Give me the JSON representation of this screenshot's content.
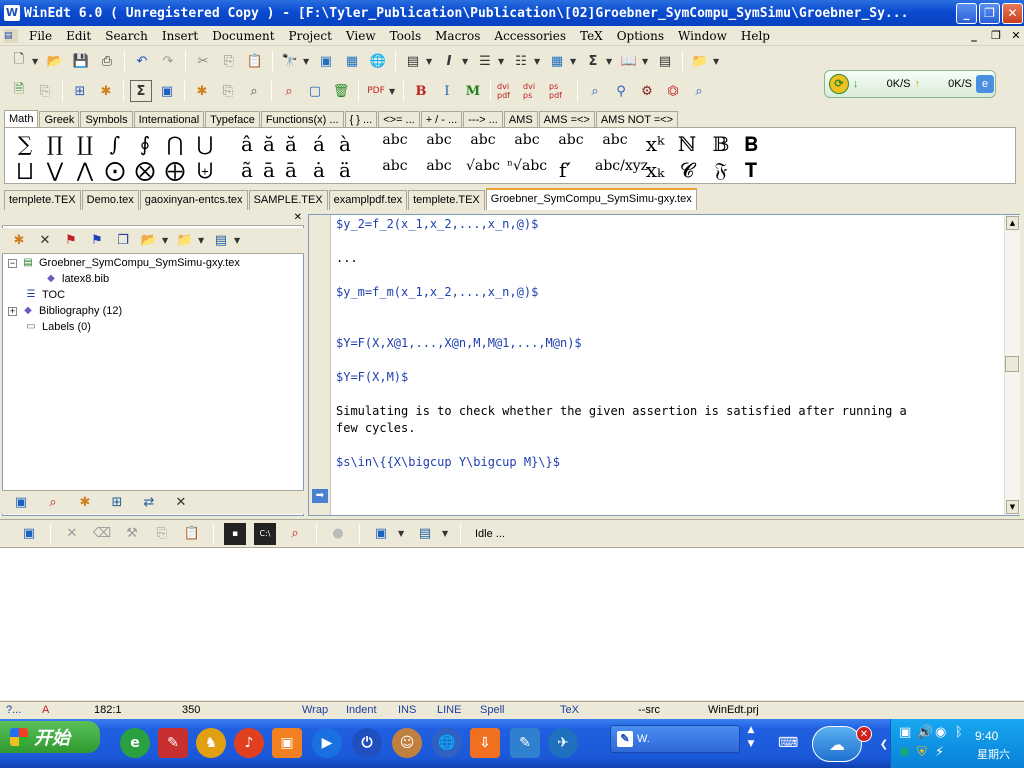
{
  "title": "WinEdt 6.0  ( Unregistered  Copy )  - [F:\\Tyler_Publication\\Publication\\[02]Groebner_SymCompu_SymSimu\\Groebner_Sy...",
  "title_short": "WinEdt 6.0",
  "menu": [
    "File",
    "Edit",
    "Search",
    "Insert",
    "Document",
    "Project",
    "View",
    "Tools",
    "Macros",
    "Accessories",
    "TeX",
    "Options",
    "Window",
    "Help"
  ],
  "net": {
    "down": "0K/S",
    "up": "0K/S"
  },
  "math_tabs": [
    "Math",
    "Greek",
    "Symbols",
    "International",
    "Typeface",
    "Functions(x) ...",
    "{ } ...",
    "<>= ...",
    "+ / - ...",
    "---> ...",
    "AMS",
    "AMS  =<>",
    "AMS NOT =<>"
  ],
  "math_symbols_row1": [
    "∑",
    "∏",
    "∐",
    "∫",
    "∮",
    "⋂",
    "⋃",
    "â",
    "ă",
    "ă",
    "á",
    "à",
    "abc",
    "abc",
    "abc",
    "abc",
    "abc",
    "abc",
    "xᵏ",
    "ℕ",
    "𝔹",
    "𝐁"
  ],
  "math_symbols_row2": [
    "⨆",
    "⋁",
    "⋀",
    "⨀",
    "⨂",
    "⨁",
    "⨄",
    "ã",
    "ā",
    "ā",
    "ȧ",
    "ä",
    "abc",
    "abc",
    "√abc",
    "ⁿ√abc",
    "f′",
    "abc/xyz",
    "xₖ",
    "𝓒",
    "𝔉",
    "𝐓"
  ],
  "file_tabs": [
    "templete.TEX",
    "Demo.tex",
    "gaoxinyan-entcs.tex",
    "SAMPLE.TEX",
    "examplpdf.tex",
    "templete.TEX",
    "Groebner_SymCompu_SymSimu-gxy.tex"
  ],
  "tree": {
    "root": "Groebner_SymCompu_SymSimu-gxy.tex",
    "child": "latex8.bib",
    "toc": "TOC",
    "bibliography": "Bibliography  (12)",
    "labels": "Labels  (0)"
  },
  "code": {
    "l1": "$y_2=f_2(x_1,x_2,...,x_n,@)$",
    "l2": "...",
    "l3": "$y_m=f_m(x_1,x_2,...,x_n,@)$",
    "l4": "$Y=F(X,X@1,...,X@n,M,M@1,...,M@n)$",
    "l5": "$Y=F(X,M)$",
    "l6": "Simulating is to check whether the given assertion is satisfied after running a",
    "l7": "few cycles.",
    "l8": "$s\\in\\{{X\\bigcup Y\\bigcup M}\\}$"
  },
  "bottom_status": "Idle ...",
  "status": {
    "help": "?...",
    "mode": "A",
    "position": "182:1",
    "lines": "350",
    "wrap": "Wrap",
    "indent": "Indent",
    "ins": "INS",
    "line": "LINE",
    "spell": "Spell",
    "tex": "TeX",
    "src": "--src",
    "project": "WinEdt.prj"
  },
  "taskbar": {
    "start": "开始",
    "task_label": "W.",
    "time": "9:40",
    "day": "星期六"
  }
}
